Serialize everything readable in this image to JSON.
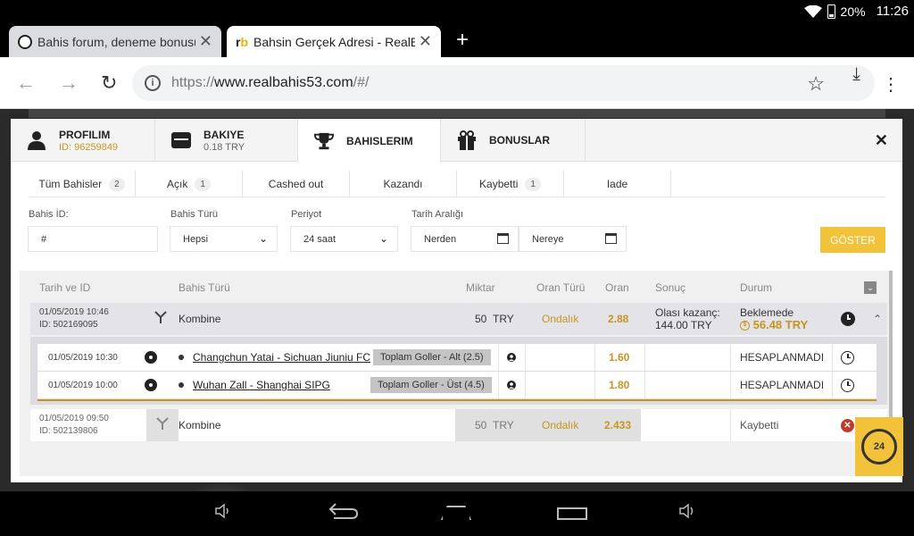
{
  "status": {
    "battery": "20%",
    "time": "11:26"
  },
  "browser": {
    "tabs": [
      {
        "title": "Bahis forum, deneme bonusu"
      },
      {
        "title": "Bahsin Gerçek Adresi - RealB"
      }
    ],
    "new_tab": "+",
    "url": {
      "scheme": "https://",
      "host": "www.realbahis53.com",
      "path": "/#/"
    }
  },
  "modal": {
    "tabs": [
      {
        "label": "PROFILIM",
        "sub": "ID: 96259849"
      },
      {
        "label": "BAKIYE",
        "sub": "0.18 TRY"
      },
      {
        "label": "BAHISLERIM",
        "sub": ""
      },
      {
        "label": "BONUSLAR",
        "sub": ""
      }
    ],
    "close": "✕",
    "filter_tabs": [
      {
        "label": "Tüm Bahisler",
        "count": "2"
      },
      {
        "label": "Açık",
        "count": "1"
      },
      {
        "label": "Cashed out",
        "count": ""
      },
      {
        "label": "Kazandı",
        "count": ""
      },
      {
        "label": "Kaybetti",
        "count": "1"
      },
      {
        "label": "Iade",
        "count": ""
      }
    ],
    "form": {
      "bet_id_label": "Bahis İD:",
      "bet_id_value": "#",
      "bet_type_label": "Bahis Türü",
      "bet_type_value": "Hepsi",
      "period_label": "Periyot",
      "period_value": "24 saat",
      "date_range_label": "Tarih Aralığı",
      "from": "Nerden",
      "to": "Nereye",
      "submit": "GÖSTER"
    },
    "table": {
      "headers": [
        "Tarih ve ID",
        "Bahis Türü",
        "Miktar",
        "Oran Türü",
        "Oran",
        "Sonuç",
        "Durum"
      ],
      "bets": [
        {
          "date": "01/05/2019 10:46",
          "id": "ID: 502169095",
          "type": "Kombine",
          "amount": "50",
          "currency": "TRY",
          "odds_type": "Ondalık",
          "odds": "2.88",
          "result_label": "Olası kazanç:",
          "result_value": "144.00 TRY",
          "status": "Beklemede",
          "status_amount": "56.48 TRY",
          "events": [
            {
              "date": "01/05/2019 10:30",
              "match": "Changchun Yatai - Sichuan Jiuniu FC",
              "market": "Toplam Goller - Alt (2.5)",
              "odds": "1.60",
              "status": "HESAPLANMADI"
            },
            {
              "date": "01/05/2019 10:00",
              "match": "Wuhan Zall - Shanghai SIPG",
              "market": "Toplam Goller - Üst (4.5)",
              "odds": "1.80",
              "status": "HESAPLANMADI"
            }
          ]
        },
        {
          "date": "01/05/2019 09:50",
          "id": "ID: 502139806",
          "type": "Kombine",
          "amount": "50",
          "currency": "TRY",
          "odds_type": "Ondalık",
          "odds": "2.433",
          "status": "Kaybetti"
        }
      ]
    }
  },
  "support": {
    "label": "24"
  }
}
